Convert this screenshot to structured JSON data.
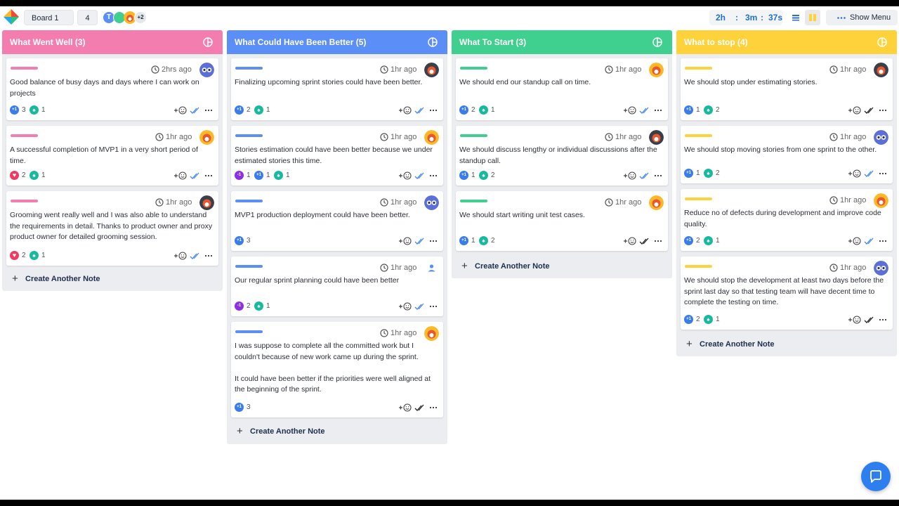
{
  "board": {
    "name": "Board 1",
    "count": "4",
    "avatars_more": "+2",
    "avatar_letter": "T",
    "timer": {
      "h": "2h",
      "m": "3m",
      "s": "37s",
      "sep": ":"
    },
    "show_menu": "Show Menu"
  },
  "colors": {
    "pink": "#f47db0",
    "blue": "#5b8ef7",
    "green": "#3fcf8e",
    "yellow": "#fdd23a",
    "link": "#1e6fd0"
  },
  "columns": [
    {
      "title": "What Went Well (3)",
      "create_label": "Create Another Note",
      "cards": [
        {
          "time": "2hrs ago",
          "text": "Good balance of busy days and days where I can work on projects",
          "reactions": [
            {
              "icon": "plus-one",
              "count": "3"
            },
            {
              "icon": "trophy",
              "count": "1"
            }
          ]
        },
        {
          "time": "1hr ago",
          "text": "A successful completion of MVP1 in a very short period of time.",
          "reactions": [
            {
              "icon": "heart",
              "count": "2"
            },
            {
              "icon": "trophy",
              "count": "1"
            }
          ]
        },
        {
          "time": "1hr ago",
          "text": "Grooming went really well and I was also able to understand the requirements in detail. Thanks to product owner and proxy product owner for detailed grooming session.",
          "reactions": [
            {
              "icon": "heart",
              "count": "2"
            },
            {
              "icon": "trophy",
              "count": "1"
            }
          ]
        }
      ]
    },
    {
      "title": "What Could Have Been Better (5)",
      "create_label": "Create Another Note",
      "cards": [
        {
          "time": "1hr ago",
          "text": "Finalizing upcoming sprint stories could have been better.",
          "reactions": [
            {
              "icon": "plus-one",
              "count": "2"
            },
            {
              "icon": "trophy",
              "count": "1"
            }
          ]
        },
        {
          "time": "1hr ago",
          "text": "Stories estimation could have been better because we under estimated stories this time.",
          "reactions": [
            {
              "icon": "minus-one",
              "count": "1"
            },
            {
              "icon": "plus-one",
              "count": "1"
            },
            {
              "icon": "trophy",
              "count": "1"
            }
          ]
        },
        {
          "time": "1hr ago",
          "text": "MVP1 production deployment could have been better.",
          "reactions": [
            {
              "icon": "plus-one",
              "count": "3"
            }
          ]
        },
        {
          "time": "1hr ago",
          "text": "Our regular sprint planning could have been better",
          "reactions": [
            {
              "icon": "minus-one",
              "count": "2"
            },
            {
              "icon": "trophy",
              "count": "1"
            }
          ]
        },
        {
          "time": "1hr ago",
          "text": "I was suppose to complete all the committed work but I couldn't because of new work came up during the sprint.\n\nIt could have been better if the priorities were well aligned at the beginning of the sprint.",
          "reactions": [
            {
              "icon": "plus-one",
              "count": "3"
            }
          ]
        }
      ]
    },
    {
      "title": "What To Start (3)",
      "create_label": "Create Another Note",
      "cards": [
        {
          "time": "1hr ago",
          "text": "We should end our standup call on time.",
          "reactions": [
            {
              "icon": "plus-one",
              "count": "2"
            },
            {
              "icon": "trophy",
              "count": "1"
            }
          ]
        },
        {
          "time": "1hr ago",
          "text": "We should discuss lengthy or individual discussions after the standup call.",
          "reactions": [
            {
              "icon": "plus-one",
              "count": "1"
            },
            {
              "icon": "trophy",
              "count": "2"
            }
          ]
        },
        {
          "time": "1hr ago",
          "text": "We should start writing unit test cases.",
          "reactions": [
            {
              "icon": "plus-one",
              "count": "1"
            },
            {
              "icon": "trophy",
              "count": "2"
            }
          ]
        }
      ]
    },
    {
      "title": "What to stop (4)",
      "create_label": "Create Another Note",
      "cards": [
        {
          "time": "1hr ago",
          "text": "We should stop under estimating stories.",
          "reactions": [
            {
              "icon": "plus-one",
              "count": "1"
            },
            {
              "icon": "trophy",
              "count": "2"
            }
          ]
        },
        {
          "time": "1hr ago",
          "text": "We should stop moving stories from one sprint to the other.",
          "reactions": [
            {
              "icon": "plus-one",
              "count": "1"
            },
            {
              "icon": "trophy",
              "count": "2"
            }
          ]
        },
        {
          "time": "1hr ago",
          "text": "Reduce no of defects during development and improve code quality.",
          "reactions": [
            {
              "icon": "plus-one",
              "count": "2"
            },
            {
              "icon": "trophy",
              "count": "1"
            }
          ]
        },
        {
          "time": "1hr ago",
          "text": "We should stop the development at least two days before the sprint last day so that testing team will have decent time to complete the testing on time.",
          "reactions": [
            {
              "icon": "plus-one",
              "count": "2"
            },
            {
              "icon": "trophy",
              "count": "1"
            }
          ]
        }
      ]
    }
  ]
}
